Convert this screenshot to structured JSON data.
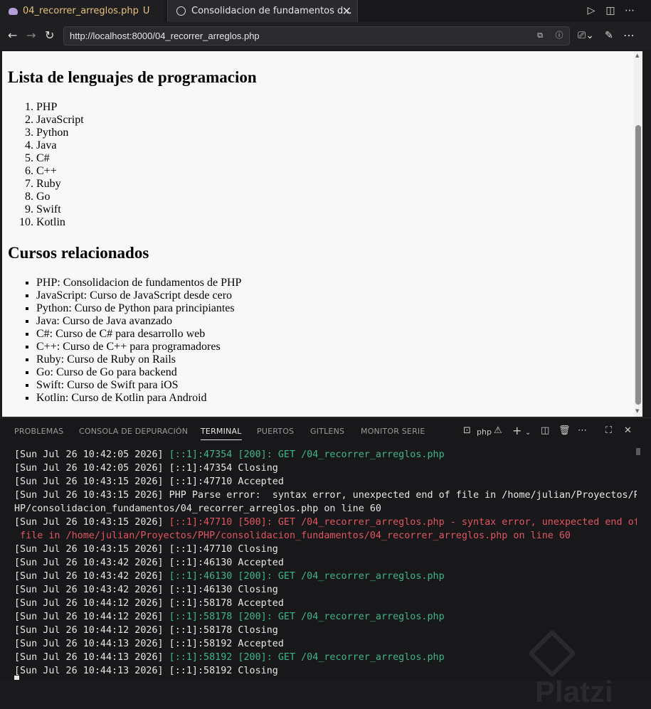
{
  "tabs": [
    {
      "title": "04_recorrer_arreglos.php",
      "status": "U"
    },
    {
      "title": "Consolidacion de fundamentos d..."
    }
  ],
  "address": {
    "url": "http://localhost:8000/04_recorrer_arreglos.php"
  },
  "page": {
    "heading_languages": "Lista de lenguajes de programacion",
    "languages": [
      "PHP",
      "JavaScript",
      "Python",
      "Java",
      "C#",
      "C++",
      "Ruby",
      "Go",
      "Swift",
      "Kotlin"
    ],
    "heading_courses": "Cursos relacionados",
    "courses": [
      "PHP: Consolidacion de fundamentos de PHP",
      "JavaScript: Curso de JavaScript desde cero",
      "Python: Curso de Python para principiantes",
      "Java: Curso de Java avanzado",
      "C#: Curso de C# para desarrollo web",
      "C++: Curso de C++ para programadores",
      "Ruby: Curso de Ruby on Rails",
      "Go: Curso de Go para backend",
      "Swift: Curso de Swift para iOS",
      "Kotlin: Curso de Kotlin para Android"
    ]
  },
  "panel": {
    "tabs": [
      "PROBLEMAS",
      "CONSOLA DE DEPURACIÓN",
      "TERMINAL",
      "PUERTOS",
      "GITLENS",
      "MONITOR SERIE"
    ],
    "active_tab": "TERMINAL",
    "shell": "php"
  },
  "terminal": [
    {
      "ts": "[Sun Jul 26 10:42:05 2026]",
      "msg": " [::1]:47354 [200]: GET /04_recorrer_arreglos.php",
      "color": "green"
    },
    {
      "ts": "[Sun Jul 26 10:42:05 2026]",
      "msg": " [::1]:47354 Closing",
      "color": "normal"
    },
    {
      "ts": "[Sun Jul 26 10:43:15 2026]",
      "msg": " [::1]:47710 Accepted",
      "color": "normal"
    },
    {
      "ts": "[Sun Jul 26 10:43:15 2026]",
      "msg": " PHP Parse error:  syntax error, unexpected end of file in /home/julian/Proyectos/P",
      "color": "normal"
    },
    {
      "ts": "",
      "msg": "HP/consolidacion_fundamentos/04_recorrer_arreglos.php on line 60",
      "color": "normal"
    },
    {
      "ts": "[Sun Jul 26 10:43:15 2026]",
      "msg": " [::1]:47710 [500]: GET /04_recorrer_arreglos.php - syntax error, unexpected end of",
      "color": "red"
    },
    {
      "ts": "",
      "msg": " file in /home/julian/Proyectos/PHP/consolidacion_fundamentos/04_recorrer_arreglos.php on line 60",
      "color": "red"
    },
    {
      "ts": "[Sun Jul 26 10:43:15 2026]",
      "msg": " [::1]:47710 Closing",
      "color": "normal"
    },
    {
      "ts": "[Sun Jul 26 10:43:42 2026]",
      "msg": " [::1]:46130 Accepted",
      "color": "normal"
    },
    {
      "ts": "[Sun Jul 26 10:43:42 2026]",
      "msg": " [::1]:46130 [200]: GET /04_recorrer_arreglos.php",
      "color": "green"
    },
    {
      "ts": "[Sun Jul 26 10:43:42 2026]",
      "msg": " [::1]:46130 Closing",
      "color": "normal"
    },
    {
      "ts": "[Sun Jul 26 10:44:12 2026]",
      "msg": " [::1]:58178 Accepted",
      "color": "normal"
    },
    {
      "ts": "[Sun Jul 26 10:44:12 2026]",
      "msg": " [::1]:58178 [200]: GET /04_recorrer_arreglos.php",
      "color": "green"
    },
    {
      "ts": "[Sun Jul 26 10:44:12 2026]",
      "msg": " [::1]:58178 Closing",
      "color": "normal"
    },
    {
      "ts": "[Sun Jul 26 10:44:13 2026]",
      "msg": " [::1]:58192 Accepted",
      "color": "normal"
    },
    {
      "ts": "[Sun Jul 26 10:44:13 2026]",
      "msg": " [::1]:58192 [200]: GET /04_recorrer_arreglos.php",
      "color": "green"
    },
    {
      "ts": "[Sun Jul 26 10:44:13 2026]",
      "msg": " [::1]:58192 Closing",
      "color": "normal"
    }
  ],
  "watermark": "Platzi",
  "colors": {
    "accent_green": "#3fb58a",
    "error_red": "#e05561",
    "tab_modified": "#e5c07b"
  }
}
